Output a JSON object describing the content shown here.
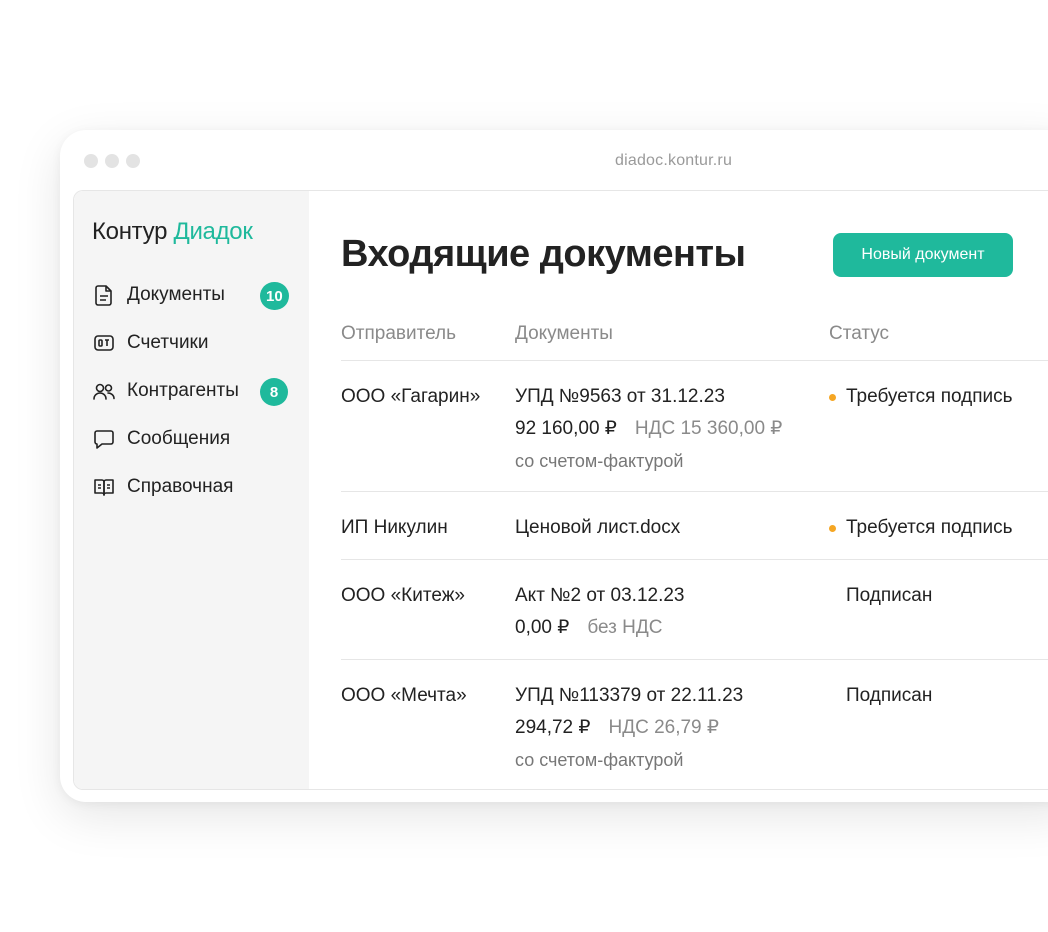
{
  "browser": {
    "url": "diadoc.kontur.ru"
  },
  "logo": {
    "brand": "Контур",
    "product": "Диадок"
  },
  "sidebar": {
    "items": [
      {
        "label": "Документы",
        "icon": "document-icon",
        "badge": "10"
      },
      {
        "label": "Счетчики",
        "icon": "counter-icon",
        "badge": ""
      },
      {
        "label": "Контрагенты",
        "icon": "people-icon",
        "badge": "8"
      },
      {
        "label": "Сообщения",
        "icon": "chat-icon",
        "badge": ""
      },
      {
        "label": "Справочная",
        "icon": "book-icon",
        "badge": ""
      }
    ]
  },
  "main": {
    "title": "Входящие документы",
    "new_doc_label": "Новый документ",
    "columns": [
      "Отправитель",
      "Документы",
      "Статус"
    ],
    "rows": [
      {
        "sender": "ООО «Гагарин»",
        "doc": "УПД №9563 от 31.12.23",
        "amount": "92 160,00 ₽",
        "vat": "НДС 15 360,00 ₽",
        "note": "со счетом-фактурой",
        "status": "Требуется подпись",
        "pending": true
      },
      {
        "sender": "ИП Никулин",
        "doc": "Ценовой лист.docx",
        "amount": "",
        "vat": "",
        "note": "",
        "status": "Требуется подпись",
        "pending": true
      },
      {
        "sender": "ООО «Китеж»",
        "doc": "Акт №2 от 03.12.23",
        "amount": "0,00 ₽",
        "vat": "без НДС",
        "note": "",
        "status": "Подписан",
        "pending": false
      },
      {
        "sender": "ООО «Мечта»",
        "doc": "УПД №113379 от 22.11.23",
        "amount": "294,72 ₽",
        "vat": "НДС 26,79 ₽",
        "note": "со счетом-фактурой",
        "status": "Подписан",
        "pending": false
      }
    ]
  },
  "colors": {
    "accent": "#1fb99c",
    "pending_dot": "#f5a623",
    "muted_text": "#8a8a8a"
  }
}
